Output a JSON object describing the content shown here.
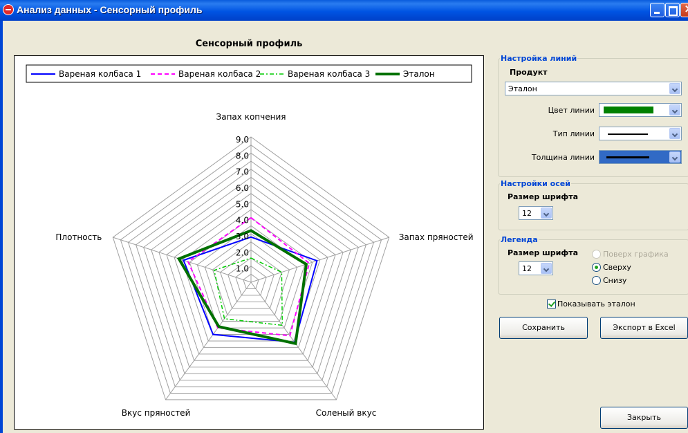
{
  "window": {
    "title": "Анализ данных - Сенсорный профиль"
  },
  "chart_data": {
    "type": "radar",
    "title": "Сенсорный профиль",
    "axes": [
      "Запах копчения",
      "Запах пряностей",
      "Соленый вкус",
      "Вкус пряностей",
      "Плотность"
    ],
    "rlim": [
      0,
      9
    ],
    "tick_labels": [
      "1.0",
      "2.0",
      "3.0",
      "4.0",
      "5.0",
      "6.0",
      "7.0",
      "8.0",
      "9.0"
    ],
    "legend_position": "top",
    "series": [
      {
        "name": "Вареная колбаса 1",
        "color": "#0000ff",
        "dash": "",
        "width": 2,
        "values": [
          2.8,
          4.3,
          4.6,
          4.0,
          4.4
        ]
      },
      {
        "name": "Вареная колбаса 2",
        "color": "#ff00ff",
        "dash": "6,4",
        "width": 2,
        "values": [
          4.0,
          3.8,
          4.1,
          3.5,
          4.1
        ]
      },
      {
        "name": "Вареная колбаса 3",
        "color": "#00cc00",
        "dash": "6,3,2,3",
        "width": 1.5,
        "values": [
          1.5,
          2.0,
          3.3,
          2.8,
          2.4
        ]
      },
      {
        "name": "Эталон",
        "color": "#007000",
        "dash": "",
        "width": 4,
        "values": [
          3.2,
          3.6,
          4.7,
          3.4,
          4.7
        ]
      }
    ]
  },
  "panel": {
    "lines": {
      "legend": "Настройка линий",
      "product_label": "Продукт",
      "product_value": "Эталон",
      "color_label": "Цвет линии",
      "color_value": "#008000",
      "type_label": "Тип линии",
      "thickness_label": "Толщина линии"
    },
    "axes": {
      "legend": "Настройки осей",
      "font_label": "Размер шрифта",
      "font_value": "12"
    },
    "legend_group": {
      "legend": "Легенда",
      "font_label": "Размер шрифта",
      "font_value": "12",
      "radio_over": "Поверх графика",
      "radio_top": "Сверху",
      "radio_bottom": "Снизу",
      "selected": "Сверху"
    },
    "show_reference": "Показывать эталон",
    "show_reference_checked": true,
    "save": "Сохранить",
    "export": "Экспорт в Excel",
    "close": "Закрыть"
  }
}
